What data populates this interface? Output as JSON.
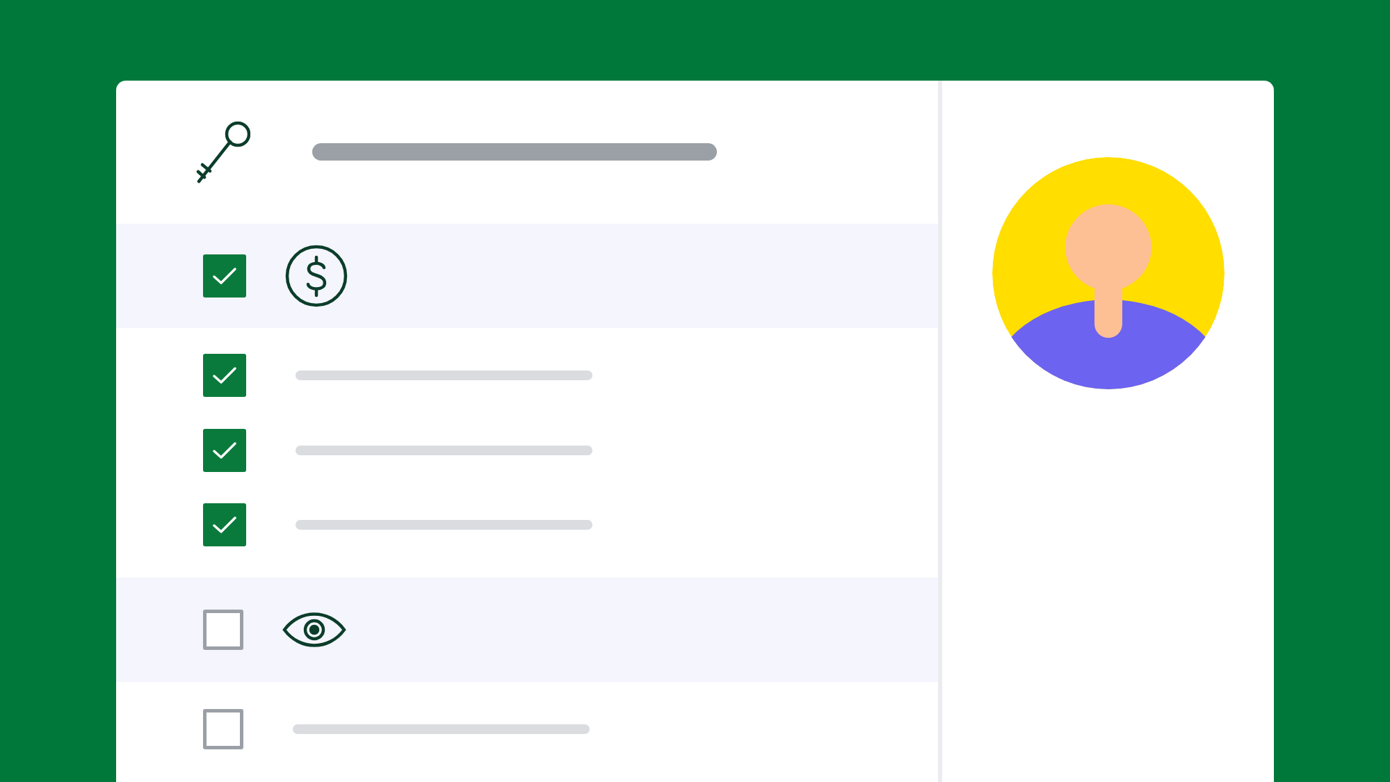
{
  "rows": [
    {
      "kind": "group",
      "checked": true
    },
    {
      "kind": "item",
      "checked": true
    },
    {
      "kind": "item",
      "checked": true
    },
    {
      "kind": "item",
      "checked": true
    },
    {
      "kind": "group",
      "checked": false
    },
    {
      "kind": "item",
      "checked": false
    }
  ]
}
